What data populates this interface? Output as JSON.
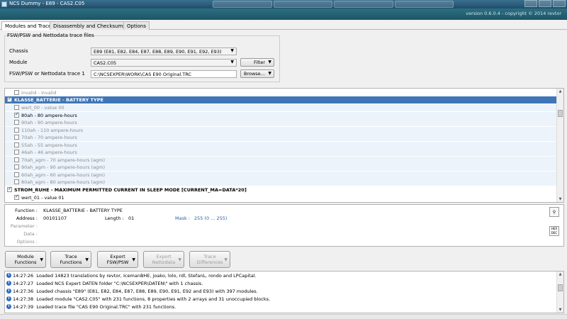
{
  "window": {
    "title": "NCS Dummy - E89 - CAS2.C05"
  },
  "banner": {
    "version": "version 0.6.0.4 - copyright © 2014 revtor"
  },
  "tabs": [
    {
      "label": "Modules and Traces"
    },
    {
      "label": "Disassembly and Checksums"
    },
    {
      "label": "Options"
    }
  ],
  "trace_files": {
    "group_title": "FSW/PSW and Nettodata trace files",
    "chassis_label": "Chassis",
    "chassis_value": "E89  (E81, E82, E84, E87, E88, E89, E90, E91, E92, E93)",
    "module_label": "Module",
    "module_value": "CAS2.C05",
    "trace_label": "FSW/PSW or Nettodata trace 1",
    "trace_value": "C:\\NCSEXPER\\WORK\\CAS E90 Original.TRC",
    "filter_label": "Filter",
    "browse_label": "Browse..."
  },
  "tree": {
    "rows": [
      {
        "text": "invalid  -  invalid"
      },
      {
        "text": "KLASSE_BATTERIE  -  BATTERY TYPE"
      },
      {
        "text": "wert_00  -  value 00"
      },
      {
        "text": "80ah  -  80 ampere-hours"
      },
      {
        "text": "90ah  -  90 ampere-hours"
      },
      {
        "text": "110ah  -  110 ampere-hours"
      },
      {
        "text": "70ah  -  70 ampere-hours"
      },
      {
        "text": "55ah  -  55 ampere-hours"
      },
      {
        "text": "46ah  -  46 ampere-hours"
      },
      {
        "text": "70ah_agm  -  70 ampere-hours (agm)"
      },
      {
        "text": "90ah_agm  -  90 ampere-hours (agm)"
      },
      {
        "text": "60ah_agm  -  60 ampere-hours (agm)"
      },
      {
        "text": "80ah_agm  -  80 ampere-hours (agm)"
      },
      {
        "text": "STROM_RUHE  -  MAXIMUM PERMITTED CURRENT IN SLEEP MODE [CURRENT_MA=DATA*20]"
      },
      {
        "text": "wert_01  -  value 01"
      }
    ]
  },
  "details": {
    "function_label": "Function :",
    "function_value": "KLASSE_BATTERIE  -  BATTERY TYPE",
    "address_label": "Address :",
    "address_value": "00101107",
    "length_label": "Length :",
    "length_value": "01",
    "mask_label": "Mask :",
    "mask_value": "255  (0 ... 255)",
    "parameter_label": "Parameter :",
    "data_label": "Data :",
    "options_label": "Options :",
    "hex_icon_label": "HEX DEC"
  },
  "function_buttons": [
    {
      "label": "Module Functions"
    },
    {
      "label": "Trace Functions"
    },
    {
      "label": "Export FSW/PSW"
    },
    {
      "label": "Export Nettodata"
    },
    {
      "label": "Trace Differences"
    }
  ],
  "log": [
    {
      "time": "14:27:26",
      "message": "Loaded 14823 translations by revtor, IcemanBHE, joako, lolo, rdl, StefanL, rondo and LPCapital."
    },
    {
      "time": "14:27:27",
      "message": "Loaded NCS Expert DATEN folder \"C:\\NCSEXPER\\DATEN\\\" with 1 chassis."
    },
    {
      "time": "14:27:36",
      "message": "Loaded chassis \"E89\" (E81, E82, E84, E87, E88, E89, E90, E91, E92 and E93) with 397 modules."
    },
    {
      "time": "14:27:38",
      "message": "Loaded module \"CAS2.C05\" with 231 functions, 8 properties with 2 arrays and 31 unoccupied blocks."
    },
    {
      "time": "14:27:39",
      "message": "Loaded trace file \"CAS E90 Original.TRC\" with 231 functions."
    }
  ],
  "colors": {
    "selection": "#3f76b7",
    "titlebar": "#1f4d6a",
    "banner": "#2c6f82",
    "mask_text": "#2d5e9e",
    "info_icon": "#2e6bc2"
  },
  "icons": {
    "app": "app-icon",
    "search": "magnifier-icon",
    "hex_dec": "hex-dec-icon",
    "log_entry": "info-icon",
    "dropdown": "chevron-down-icon"
  }
}
